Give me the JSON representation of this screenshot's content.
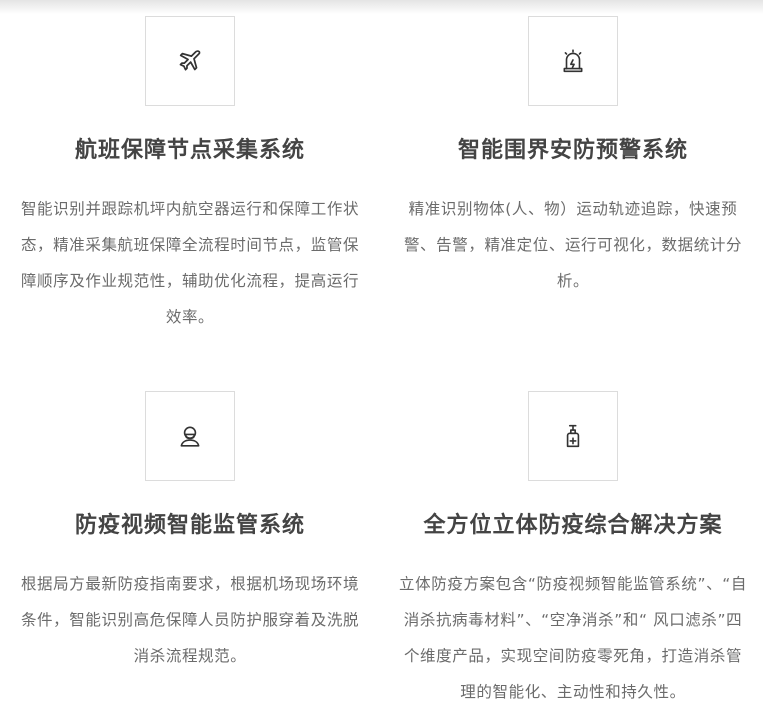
{
  "features": [
    {
      "icon": "airplane-icon",
      "title": "航班保障节点采集系统",
      "description": "智能识别并跟踪机坪内航空器运行和保障工作状态，精准采集航班保障全流程时间节点，监管保障顺序及作业规范性，辅助优化流程，提高运行效率。"
    },
    {
      "icon": "alarm-light-icon",
      "title": "智能围界安防预警系统",
      "description": "精准识别物体(人、物）运动轨迹追踪，快速预警、告警，精准定位、运行可视化，数据统计分析。"
    },
    {
      "icon": "masked-person-icon",
      "title": "防疫视频智能监管系统",
      "description": "根据局方最新防疫指南要求，根据机场现场环境条件，智能识别高危保障人员防护服穿着及洗脱消杀流程规范。"
    },
    {
      "icon": "sanitizer-bottle-icon",
      "title": "全方位立体防疫综合解决方案",
      "description": "立体防疫方案包含“防疫视频智能监管系统”、“自消杀抗病毒材料”、“空净消杀”和“ 风口滤杀”四个维度产品，实现空间防疫零死角，打造消杀管理的智能化、主动性和持久性。"
    }
  ]
}
